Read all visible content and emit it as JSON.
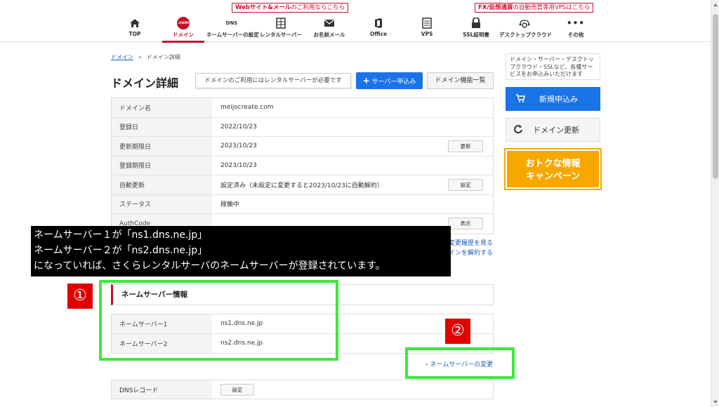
{
  "promos": {
    "web_bold": "Webサイト&メール",
    "web_rest": "のご利用ならこちら",
    "fx_bold": "FX/仮想通貨",
    "fx_rest": "の自動売買専用VPSはこちら"
  },
  "nav": [
    {
      "label": "TOP",
      "icon": "home-icon"
    },
    {
      "label": "ドメイン",
      "icon": "com-domain-icon",
      "icon_text": ".com"
    },
    {
      "label": "ネームサーバーの設定",
      "icon": "dns-icon",
      "icon_text": "DNS"
    },
    {
      "label": "レンタルサーバー",
      "icon": "server-icon"
    },
    {
      "label": "お名前メール",
      "icon": "mail-icon"
    },
    {
      "label": "Office",
      "icon": "office-icon"
    },
    {
      "label": "VPS",
      "icon": "vps-icon"
    },
    {
      "label": "SSL証明書",
      "icon": "lock-icon"
    },
    {
      "label": "デスクトップクラウド",
      "icon": "cloud-desktop-icon"
    },
    {
      "label": "その他",
      "icon": "more-icon",
      "icon_text": "•••"
    }
  ],
  "breadcrumb": {
    "root": "ドメイン",
    "sep": ">",
    "current": "ドメイン詳細"
  },
  "page_title": "ドメイン詳細",
  "notice": "ドメインのご利用にはレンタルサーバーが必要です",
  "buttons": {
    "apply": "サーバー申込み",
    "apply_plus": "+",
    "feature_list": "ドメイン機能一覧"
  },
  "details": [
    {
      "key": "ドメイン名",
      "value": "meijocreate.com"
    },
    {
      "key": "登録日",
      "value": "2022/10/23"
    },
    {
      "key": "更新期限日",
      "value": "2023/10/23",
      "button": "更新"
    },
    {
      "key": "登録期限日",
      "value": "2023/10/23"
    },
    {
      "key": "自動更新",
      "value": "設定済み（未設定に変更すると2023/10/23に自動解約）",
      "button": "設定"
    },
    {
      "key": "ステータス",
      "value": "稼働中"
    },
    {
      "key": "AuthCode",
      "value": "",
      "button": "表示"
    }
  ],
  "side_links": {
    "history": "変更履歴を見る",
    "cancel": "インを解約する"
  },
  "annotation": {
    "line1": "ネームサーバー１が「ns1.dns.ne.jp」",
    "line2": "ネームサーバー２が「ns2.dns.ne.jp」",
    "line3": "になっていれば、さくらレンタルサーバのネームサーバーが登録されています。"
  },
  "badges": {
    "one": "①",
    "two": "②"
  },
  "nameserver": {
    "title": "ネームサーバー情報",
    "rows": [
      {
        "key": "ネームサーバー1",
        "value": "ns1.dns.ne.jp"
      },
      {
        "key": "ネームサーバー2",
        "value": "ns2.dns.ne.jp"
      }
    ],
    "change_link": "ネームサーバーの変更",
    "change_arrow": "›"
  },
  "dns_record": {
    "key": "DNSレコード",
    "button": "設定"
  },
  "sidebar": {
    "description": "ドメイン・サーバー・デスクトップクラウド・SSLなど、各種サービスをお申込みいただけます",
    "new_order": "新規申込み",
    "renew": "ドメイン更新",
    "campaign_line1": "おトクな情報",
    "campaign_line2": "キャンペーン"
  },
  "colors": {
    "accent_red": "#c8102e",
    "primary_blue": "#1a73e8",
    "highlight_green": "#3ee83e",
    "badge_red": "#e00000",
    "campaign_orange": "#f6a800"
  }
}
